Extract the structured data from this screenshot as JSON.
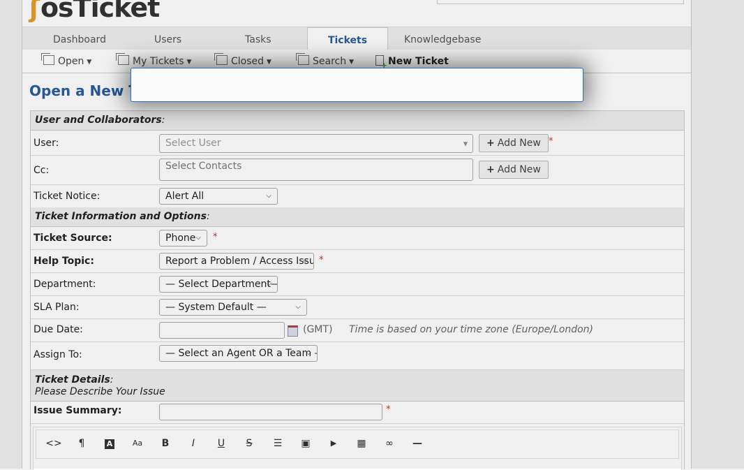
{
  "app": {
    "logo_text": "osTicket"
  },
  "nav": {
    "tabs": [
      {
        "label": "Dashboard"
      },
      {
        "label": "Users"
      },
      {
        "label": "Tasks"
      },
      {
        "label": "Tickets",
        "active": true
      },
      {
        "label": "Knowledgebase"
      }
    ]
  },
  "subnav": {
    "open": "Open",
    "my_tickets": "My Tickets",
    "closed": "Closed",
    "search": "Search",
    "new_ticket": "New Ticket"
  },
  "page": {
    "title": "Open a New Tic"
  },
  "form": {
    "sections": {
      "user": "User and Collaborators",
      "info": "Ticket Information and Options",
      "details": "Ticket Details",
      "details_sub": "Please Describe Your Issue"
    },
    "user": {
      "label": "User:",
      "placeholder": "Select User",
      "add_label": "Add New"
    },
    "cc": {
      "label": "Cc:",
      "placeholder": "Select Contacts",
      "add_label": "Add New"
    },
    "notice": {
      "label": "Ticket Notice:",
      "value": "Alert All"
    },
    "source": {
      "label": "Ticket Source:",
      "value": "Phone"
    },
    "topic": {
      "label": "Help Topic:",
      "value": "Report a Problem / Access Issue"
    },
    "department": {
      "label": "Department:",
      "value": "— Select Department—"
    },
    "sla": {
      "label": "SLA Plan:",
      "value": "— System Default —"
    },
    "due": {
      "label": "Due Date:",
      "value": "",
      "tz_short": "(GMT)",
      "tz_note": "Time is based on your time zone (Europe/London)"
    },
    "assign": {
      "label": "Assign To:",
      "value": "— Select an Agent OR a Team —"
    },
    "summary": {
      "label": "Issue Summary:",
      "value": ""
    },
    "required_mark": "*"
  },
  "editor": {
    "tools": [
      {
        "icon": "code-icon",
        "glyph": "<>"
      },
      {
        "icon": "paragraph-icon",
        "glyph": "¶"
      },
      {
        "icon": "text-color-icon",
        "glyph": "A"
      },
      {
        "icon": "font-size-icon",
        "glyph": "Aa"
      },
      {
        "icon": "bold-icon",
        "glyph": "B"
      },
      {
        "icon": "italic-icon",
        "glyph": "I"
      },
      {
        "icon": "underline-icon",
        "glyph": "U"
      },
      {
        "icon": "strikethrough-icon",
        "glyph": "S"
      },
      {
        "icon": "list-icon",
        "glyph": "☰"
      },
      {
        "icon": "image-icon",
        "glyph": "▣"
      },
      {
        "icon": "video-icon",
        "glyph": "▶"
      },
      {
        "icon": "table-icon",
        "glyph": "▦"
      },
      {
        "icon": "link-icon",
        "glyph": "∞"
      },
      {
        "icon": "horizontal-rule-icon",
        "glyph": "—"
      }
    ]
  },
  "colors": {
    "accent": "#2a5d9e",
    "required": "#cc3333",
    "dialog_border": "#2a6bc9"
  }
}
